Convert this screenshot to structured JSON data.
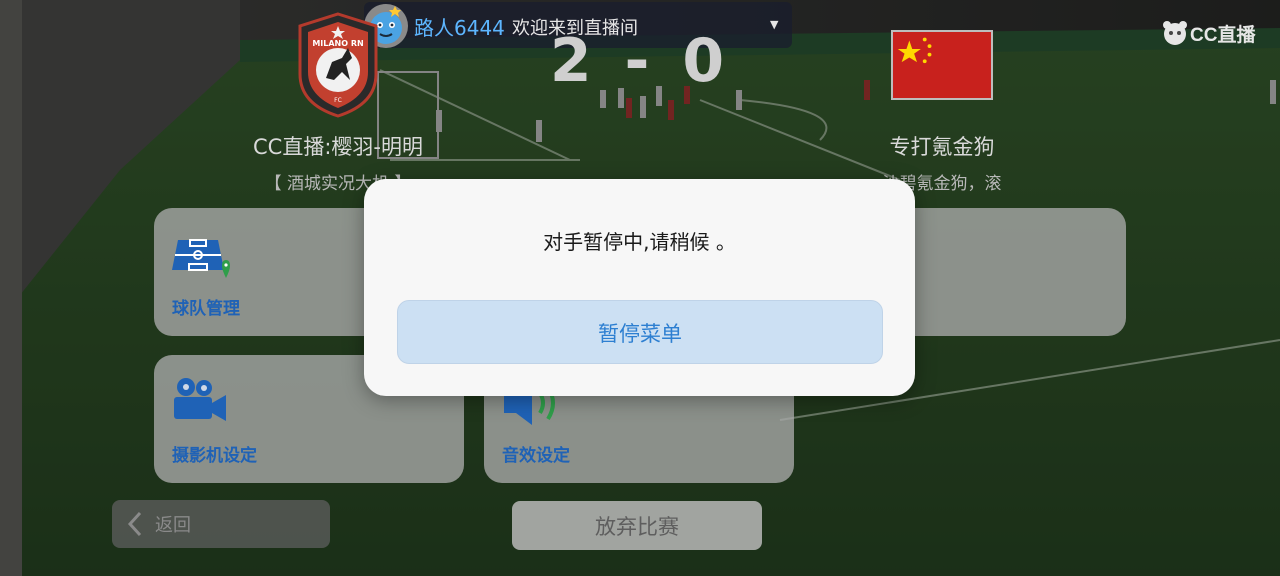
{
  "stream": {
    "viewer_name": "路人6444",
    "viewer_welcome": "欢迎来到直播间",
    "platform_logo_text": "CC直播"
  },
  "scoreboard": {
    "home": {
      "crest_text": "MILANO RN",
      "crest_fc": "FC",
      "name": "CC直播:樱羽-明明",
      "subtitle": "【 酒城实况大机 】"
    },
    "away": {
      "flag": "china-flag",
      "name": "专打氪金狗",
      "subtitle": "沙碧氪金狗，滚"
    },
    "score_display": "2 - 0"
  },
  "pause_menu": {
    "team_management": "球队管理",
    "camera_settings": "摄影机设定",
    "sound_settings": "音效设定",
    "back": "返回",
    "forfeit": "放弃比赛"
  },
  "dialog": {
    "message": "对手暂停中,请稍候 。",
    "button_label": "暂停菜单"
  },
  "colors": {
    "accent_blue": "#2d7fd1",
    "menu_label_blue": "#1f62b6",
    "viewer_name_blue": "#5db6ff",
    "flag_red": "#d41f1f",
    "flag_yellow": "#ffd800"
  }
}
